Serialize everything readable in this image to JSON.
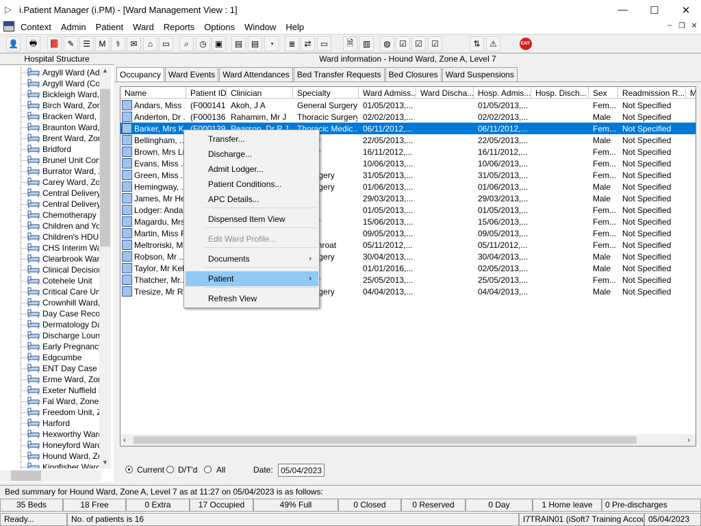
{
  "window": {
    "title": "i.Patient Manager (i.PM) - [Ward Management View : 1]",
    "minimize": "—",
    "maximize": "☐",
    "close": "✕"
  },
  "menubar": {
    "items": [
      "Context",
      "Admin",
      "Patient",
      "Ward",
      "Reports",
      "Options",
      "Window",
      "Help"
    ],
    "mdi_min": "–",
    "mdi_restore": "❐",
    "mdi_close": "✕"
  },
  "toolbar": {
    "icons": [
      "user-icon",
      "print-icon",
      "book-icon",
      "edit-icon",
      "list-icon",
      "m-icon",
      "doctor-icon",
      "note-icon",
      "ward-icon",
      "bed-icon",
      "search-icon",
      "clock-icon",
      "monitor-icon",
      "screen-icon",
      "screen-icon",
      "chart-icon",
      "notes-icon",
      "transfer-icon",
      "bed-icon",
      "document-icon",
      "bar-chart-icon",
      "globe-icon",
      "checklist-icon",
      "checklist-icon",
      "checklist-icon",
      "swap-icon",
      "warning-icon",
      "exit-icon"
    ],
    "exit_label": "EXIT"
  },
  "left_panel": {
    "header": "Hospital Structure",
    "items": [
      "Argyll Ward (Adul",
      "Argyll Ward (Cots",
      "Bickleigh Ward, Z",
      "Birch Ward, Zone",
      "Bracken Ward, Z",
      "Braunton Ward, Z",
      "Brent Ward, Zone",
      "Bridford",
      "Brunel Unit Contin",
      "Burrator Ward, Zo",
      "Carey Ward, Zon",
      "Central Delivery S",
      "Central Delivery S",
      "Chemotherapy Da",
      "Children and You",
      "Children's HDU (N",
      "CHS Interim Ward",
      "Clearbrook Ward,",
      "Clinical Decision U",
      "Cotehele Unit",
      "Critical Care Unit",
      "Crownhill Ward, Z",
      "Day Case Recov",
      "Dermatology Day",
      "Discharge Loung",
      "Early Pregnancy U",
      "Edgcumbe",
      "ENT Day Case U",
      "Erme Ward, Zone",
      "Exeter Nuffield He",
      "Fal Ward, Zone E",
      "Freedom Unit, Zo",
      "Harford",
      "Hexworthy Ward,",
      "Honeyford Ward,",
      "Hound Ward, Zor",
      "Kingfisher Ward"
    ]
  },
  "ward_info": "Ward information - Hound Ward, Zone A, Level 7",
  "tabs": [
    "Occupancy",
    "Ward Events",
    "Ward Attendances",
    "Bed Transfer Requests",
    "Bed Closures",
    "Ward Suspensions"
  ],
  "grid": {
    "columns": [
      "Name",
      "Patient ID",
      "Clinician",
      "Specialty",
      "Ward Admiss...",
      "Ward Discha...",
      "Hosp. Admis...",
      "Hosp. Disch...",
      "Sex",
      "Readmission R...",
      "Me"
    ],
    "rows": [
      [
        "Andars, Miss ...",
        "(F000141)",
        "Akoh, J A",
        "General Surgery",
        "01/05/2013,...",
        "",
        "01/05/2013,...",
        "",
        "Fem...",
        "Not Specified"
      ],
      [
        "Anderton, Dr ...",
        "(F000136)",
        "Rahamim, Mr J",
        "Thoracic Surgery",
        "02/02/2013,...",
        "",
        "02/02/2013,...",
        "",
        "Male",
        "Not Specified"
      ],
      [
        "Barker, Mrs K...",
        "(F000139)",
        "Pearson, Dr P J",
        "Thoracic Medic...",
        "06/11/2012,...",
        "",
        "06/11/2012,...",
        "",
        "Fem...",
        "Not Specified"
      ],
      [
        "Bellingham, ...",
        "",
        "",
        "urgery",
        "22/05/2013,...",
        "",
        "22/05/2013,...",
        "",
        "Male",
        "Not Specified"
      ],
      [
        "Brown, Mrs Li...",
        "",
        "",
        "urgery",
        "16/11/2012,...",
        "",
        "16/11/2012,...",
        "",
        "Fem...",
        "Not Specified"
      ],
      [
        "Evans, Miss ...",
        "",
        "",
        "ogy",
        "10/06/2013,...",
        "",
        "10/06/2013,...",
        "",
        "Fem...",
        "Not Specified"
      ],
      [
        "Green, Miss ...",
        "",
        "",
        "al Surgery",
        "31/05/2013,...",
        "",
        "31/05/2013,...",
        "",
        "Fem...",
        "Not Specified"
      ],
      [
        "Hemingway, ...",
        "",
        "",
        "al Surgery",
        "01/06/2013,...",
        "",
        "01/06/2013,...",
        "",
        "Male",
        "Not Specified"
      ],
      [
        "James, Mr He...",
        "",
        "",
        "& E",
        "29/03/2013,...",
        "",
        "29/03/2013,...",
        "",
        "Male",
        "Not Specified"
      ],
      [
        "Lodger: Anda...",
        "",
        "",
        "",
        "01/05/2013,...",
        "",
        "01/05/2013,...",
        "",
        "Fem...",
        "Not Specified"
      ],
      [
        "Magardu, Mrs...",
        "",
        "",
        "urgery",
        "15/06/2013,...",
        "",
        "15/06/2013,...",
        "",
        "Fem...",
        "Not Specified"
      ],
      [
        "Martin, Miss F...",
        "",
        "",
        "aedic",
        "09/05/2013,...",
        "",
        "09/05/2013,...",
        "",
        "Fem...",
        "Not Specified"
      ],
      [
        "Meltroriski, Mr...",
        "",
        "",
        "ase Throat",
        "05/11/2012,...",
        "",
        "05/11/2012,...",
        "",
        "Fem...",
        "Not Specified"
      ],
      [
        "Robson, Mr ...",
        "",
        "",
        "al Surgery",
        "30/04/2013,...",
        "",
        "30/04/2013,...",
        "",
        "Male",
        "Not Specified"
      ],
      [
        "Taylor, Mr Kel...",
        "",
        "",
        "aedic",
        "01/01/2016,...",
        "",
        "02/05/2013,...",
        "",
        "Male",
        "Not Specified"
      ],
      [
        "Thatcher, Mr...",
        "",
        "",
        "urgery",
        "25/05/2013,...",
        "",
        "25/05/2013,...",
        "",
        "Fem...",
        "Not Specified"
      ],
      [
        "Tresize, Mr R...",
        "",
        "",
        "al Surgery",
        "04/04/2013,...",
        "",
        "04/04/2013,...",
        "",
        "Male",
        "Not Specified"
      ]
    ],
    "selected_row": 2
  },
  "context_menu": {
    "items": [
      {
        "label": "Transfer...",
        "disabled": false
      },
      {
        "label": "Discharge...",
        "disabled": false
      },
      {
        "label": "Admit Lodger...",
        "disabled": false
      },
      {
        "label": "Patient Conditions...",
        "disabled": false
      },
      {
        "label": "APC Details...",
        "disabled": false
      },
      {
        "label": "Dispensed Item View",
        "disabled": false
      },
      {
        "label": "Edit Ward Profile...",
        "disabled": true
      },
      {
        "label": "Documents",
        "disabled": false,
        "submenu": true
      },
      {
        "label": "Patient",
        "disabled": false,
        "submenu": true,
        "highlighted": true
      },
      {
        "label": "Refresh View",
        "disabled": false
      }
    ],
    "submenu_arrow": "›"
  },
  "filters": {
    "current": "Current",
    "dtd": "D/T'd",
    "all": "All",
    "selected": "Current",
    "date_label": "Date:",
    "date_value": "05/04/2023"
  },
  "summary": "Bed summary for Hound Ward, Zone A, Level 7 as at 11:27 on 05/04/2023 is as follows:",
  "counts": [
    "35 Beds",
    "18 Free",
    "0 Extra",
    "17 Occupied",
    "49% Full",
    "0 Closed",
    "0 Reserved",
    "0 Day",
    "1 Home leave",
    "0 Pre-discharges"
  ],
  "status": {
    "ready": "Ready...",
    "patients": "No. of patients is 16",
    "account": "I7TRAIN01 (iSoft7 Training Account)",
    "date": "05/04/2023"
  },
  "colors": {
    "selection": "#0078d7",
    "menu_highlight": "#91c9f7"
  }
}
